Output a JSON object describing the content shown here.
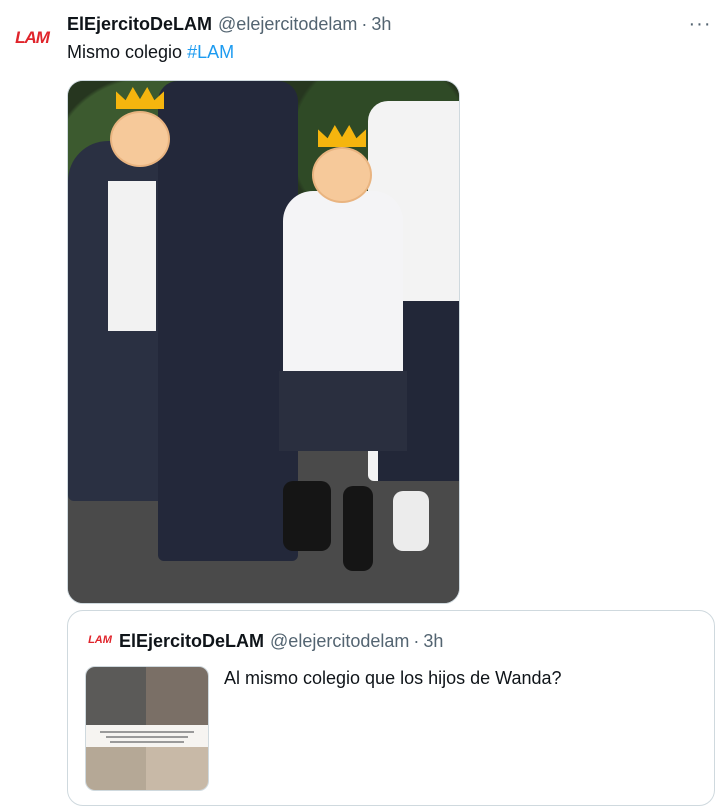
{
  "tweet": {
    "avatar_text": "LAM",
    "display_name": "ElEjercitoDeLAM",
    "handle": "@elejercitodelam",
    "separator": "·",
    "time": "3h",
    "more_icon": "···",
    "text": "Mismo colegio",
    "hashtag": "#LAM"
  },
  "quoted_tweet": {
    "avatar_text": "LAM",
    "display_name": "ElEjercitoDeLAM",
    "handle": "@elejercitodelam",
    "separator": "·",
    "time": "3h",
    "text": "Al mismo colegio que los hijos de Wanda?"
  },
  "colors": {
    "brand_red": "#e0242b",
    "link_blue": "#1d9bf0",
    "secondary_text": "#536471",
    "border": "#cfd9de"
  },
  "icons": [
    "more-options-icon"
  ]
}
